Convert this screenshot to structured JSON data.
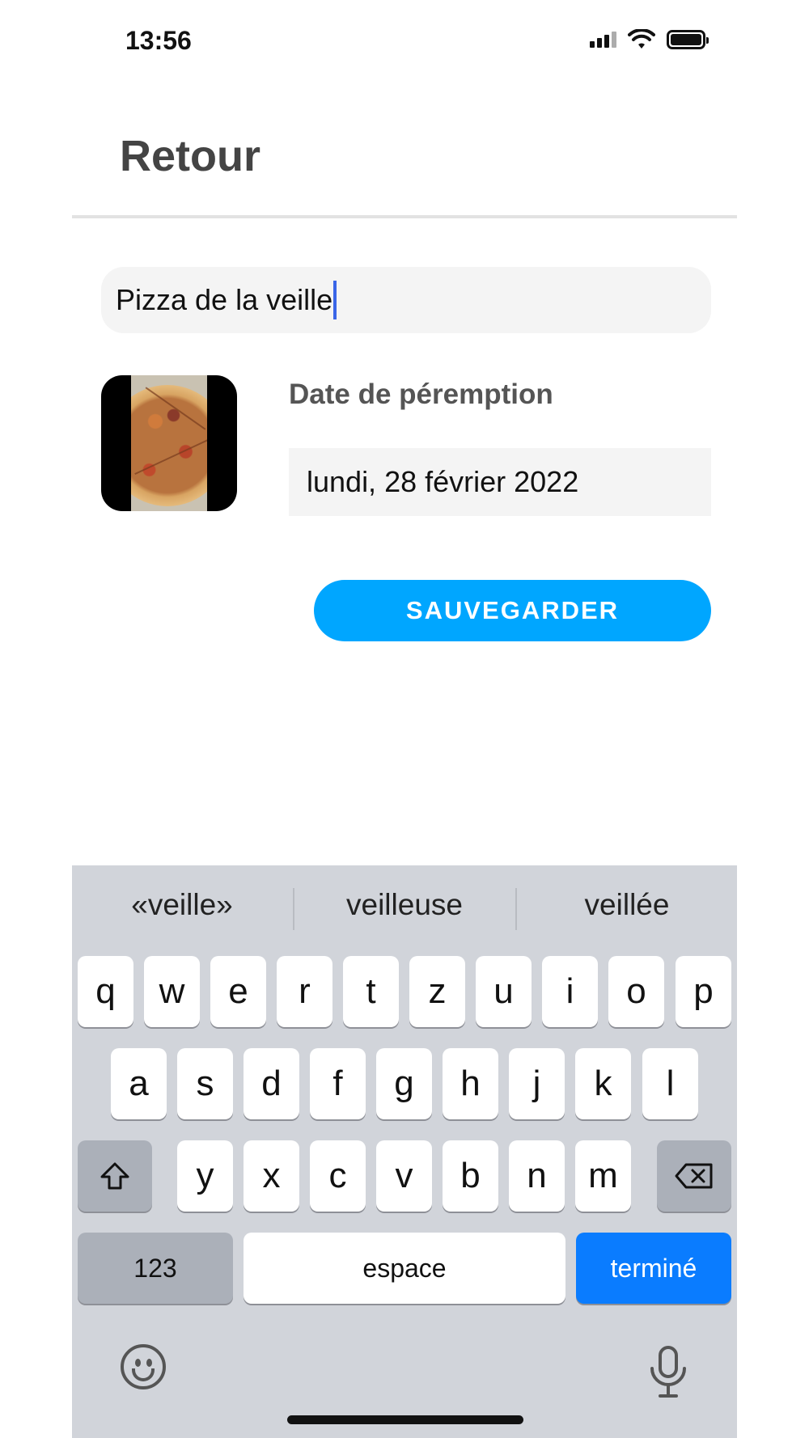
{
  "status_bar": {
    "time": "13:56"
  },
  "header": {
    "back_label": "Retour"
  },
  "form": {
    "name_value": "Pizza de la veille",
    "date_label": "Date de péremption",
    "date_value": "lundi, 28 février 2022",
    "save_label": "SAUVEGARDER"
  },
  "keyboard": {
    "suggestions": [
      "«veille»",
      "veilleuse",
      "veillée"
    ],
    "row1": [
      "q",
      "w",
      "e",
      "r",
      "t",
      "z",
      "u",
      "i",
      "o",
      "p"
    ],
    "row2": [
      "a",
      "s",
      "d",
      "f",
      "g",
      "h",
      "j",
      "k",
      "l"
    ],
    "row3": [
      "y",
      "x",
      "c",
      "v",
      "b",
      "n",
      "m"
    ],
    "numbers_label": "123",
    "space_label": "espace",
    "done_label": "terminé"
  },
  "colors": {
    "accent": "#00a6ff",
    "done_key": "#0a7cff",
    "keyboard_bg": "#d1d4da"
  }
}
